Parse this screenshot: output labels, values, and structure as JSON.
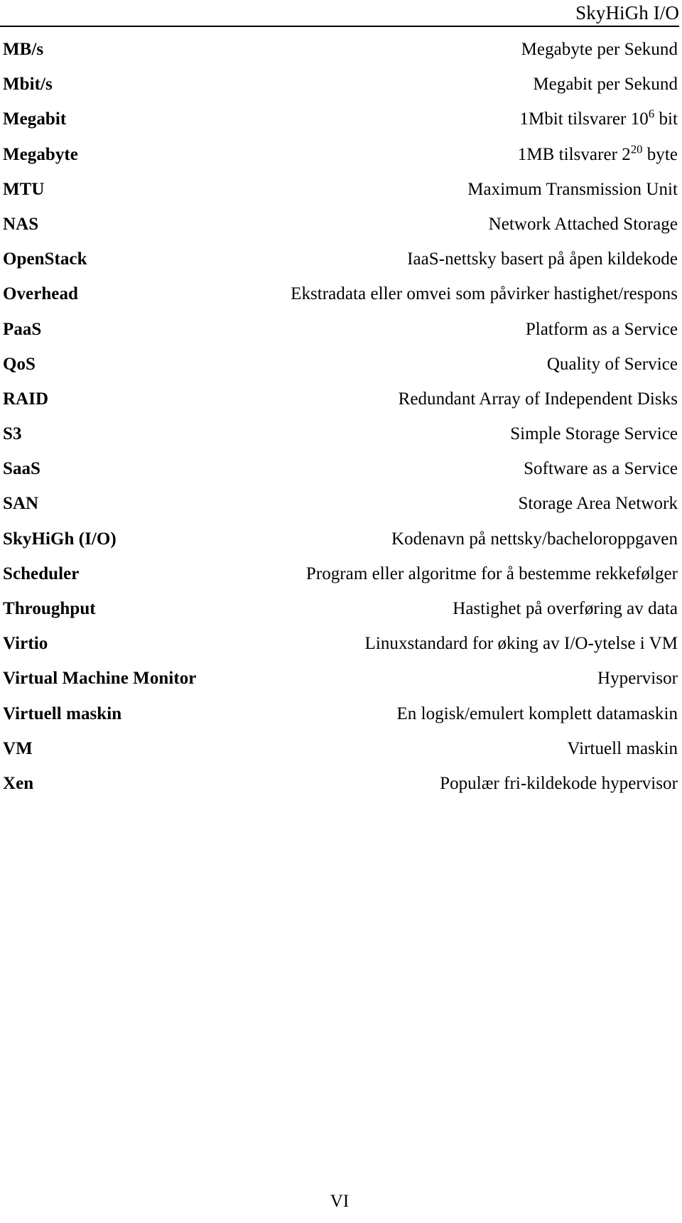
{
  "header": {
    "running_title": "SkyHiGh I/O"
  },
  "glossary": {
    "rows": [
      {
        "term": "MB/s",
        "desc": "Megabyte per Sekund"
      },
      {
        "term": "Mbit/s",
        "desc": "Megabit per Sekund"
      },
      {
        "term": "Megabit",
        "desc": "1Mbit tilsvarer 10",
        "sup": "6",
        "desc_tail": " bit"
      },
      {
        "term": "Megabyte",
        "desc": "1MB tilsvarer 2",
        "sup": "20",
        "desc_tail": " byte"
      },
      {
        "term": "MTU",
        "desc": "Maximum Transmission Unit"
      },
      {
        "term": "NAS",
        "desc": "Network Attached Storage"
      },
      {
        "term": "OpenStack",
        "desc": "IaaS-nettsky basert på åpen kildekode"
      },
      {
        "term": "Overhead",
        "desc": "Ekstradata eller omvei som påvirker hastighet/respons"
      },
      {
        "term": "PaaS",
        "desc": "Platform as a Service"
      },
      {
        "term": "QoS",
        "desc": "Quality of Service"
      },
      {
        "term": "RAID",
        "desc": "Redundant Array of Independent Disks"
      },
      {
        "term": "S3",
        "desc": "Simple Storage Service"
      },
      {
        "term": "SaaS",
        "desc": "Software as a Service"
      },
      {
        "term": "SAN",
        "desc": "Storage Area Network"
      },
      {
        "term": "SkyHiGh (I/O)",
        "desc": "Kodenavn på nettsky/bacheloroppgaven"
      },
      {
        "term": "Scheduler",
        "desc": "Program eller algoritme for å bestemme rekkefølger"
      },
      {
        "term": "Throughput",
        "desc": "Hastighet på overføring av data"
      },
      {
        "term": "Virtio",
        "desc": "Linuxstandard for øking av I/O-ytelse i VM"
      },
      {
        "term": "Virtual Machine Monitor",
        "desc": "Hypervisor"
      },
      {
        "term": "Virtuell maskin",
        "desc": "En logisk/emulert komplett datamaskin"
      },
      {
        "term": "VM",
        "desc": "Virtuell maskin"
      },
      {
        "term": "Xen",
        "desc": "Populær fri-kildekode hypervisor"
      }
    ]
  },
  "footer": {
    "page_number": "VI"
  }
}
